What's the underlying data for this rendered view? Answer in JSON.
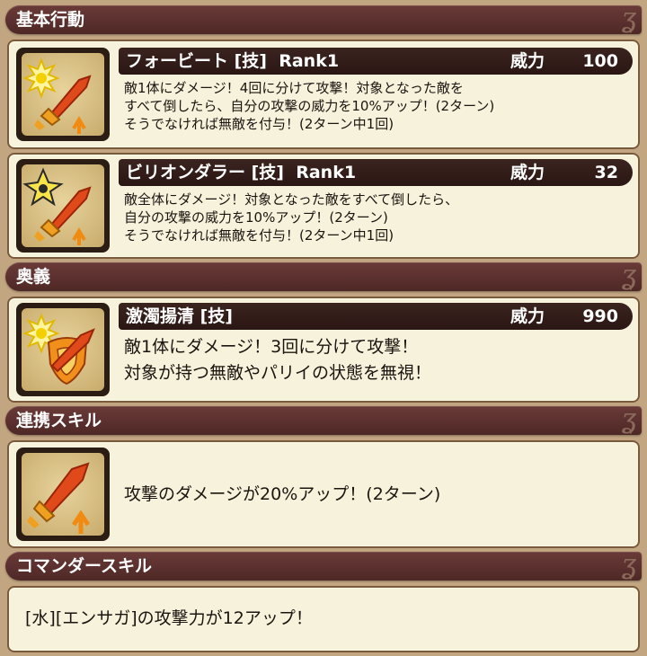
{
  "sections": {
    "basic": {
      "title": "基本行動"
    },
    "ougi": {
      "title": "奥義"
    },
    "renkei": {
      "title": "連携スキル"
    },
    "commander": {
      "title": "コマンダースキル"
    }
  },
  "skills": [
    {
      "name": "フォービート [技]  Rank1",
      "power_label": "威力",
      "power_value": "100",
      "desc": [
        "敵1体にダメージ！4回に分けて攻撃！対象となった敵を",
        "すべて倒したら、自分の攻撃の威力を10%アップ！(2ターン)",
        "そうでなければ無敵を付与！(2ターン中1回)"
      ],
      "icon": "sword-burst-icon"
    },
    {
      "name": "ビリオンダラー [技]  Rank1",
      "power_label": "威力",
      "power_value": "32",
      "desc": [
        "敵全体にダメージ！対象となった敵をすべて倒したら、",
        "自分の攻撃の威力を10%アップ！(2ターン)",
        "そうでなければ無敵を付与！(2ターン中1回)"
      ],
      "icon": "sword-star-icon"
    },
    {
      "name": "激濁揚清 [技]",
      "power_label": "威力",
      "power_value": "990",
      "desc": [
        "敵1体にダメージ！3回に分けて攻撃！",
        "対象が持つ無敵やパリイの状態を無視！"
      ],
      "icon": "shield-break-icon"
    }
  ],
  "renkei_skill": {
    "text": "攻撃のダメージが20%アップ！(2ターン)",
    "icon": "attack-up-icon"
  },
  "commander_skill": {
    "text": "[水][エンサガ]の攻撃力が12アップ！"
  },
  "colors": {
    "background": "#c2a682",
    "header": "#5a302e",
    "panel": "#f6f2dc",
    "title_bar": "#2f1a17"
  }
}
